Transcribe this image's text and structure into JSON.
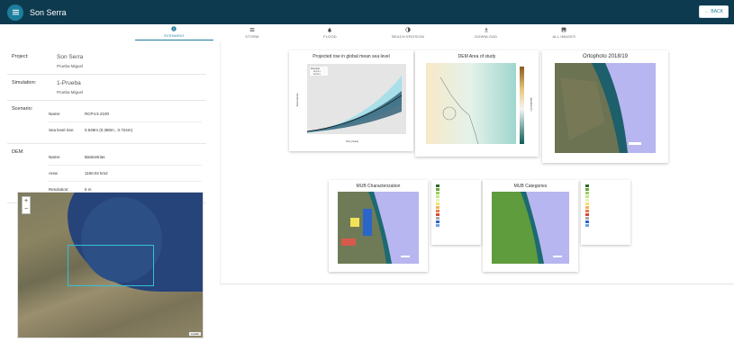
{
  "app": {
    "title": "Son Serra",
    "back_label": "BACK"
  },
  "tabs": [
    {
      "label": "SCENARIO",
      "icon": "info-icon",
      "active": true
    },
    {
      "label": "STORM",
      "icon": "storm-icon",
      "active": false
    },
    {
      "label": "FLOOD",
      "icon": "water-drop-icon",
      "active": false
    },
    {
      "label": "BEACH EROSION",
      "icon": "erosion-icon",
      "active": false
    },
    {
      "label": "DOWNLOAD",
      "icon": "download-icon",
      "active": false
    },
    {
      "label": "ALL IMAGES",
      "icon": "image-icon",
      "active": false
    }
  ],
  "info": {
    "project_label": "Project:",
    "project_name": "Son Serra",
    "project_owner": "Prueba Miguel",
    "simulation_label": "Simulation:",
    "simulation_name": "1-Prueba",
    "simulation_owner": "Prueba Miguel",
    "scenario_label": "Scenario:",
    "scenario_name_key": "Name:",
    "scenario_name": "RCP4.5 2100",
    "sea_level_key": "Sea level rise:",
    "sea_level": "0.549m (0.380m , 0.724m)",
    "dem_label": "DEM:",
    "dem_name_key": "Name:",
    "dem_name": "Batimetrias",
    "dem_area_key": "Area:",
    "dem_area": "1160.02 km2",
    "dem_res_key": "Resolution:",
    "dem_res": "5 m"
  },
  "map": {
    "zoom_in": "+",
    "zoom_out": "−",
    "attribution": "Leaflet"
  },
  "cards": {
    "sea_level_title": "Projected rise in global mean sea level",
    "sea_level_legend_title": "Scenario",
    "sea_level_legend": [
      "RCP4.5",
      "RCP8.5"
    ],
    "sea_level_xlabel": "Time (Years)",
    "sea_level_ylabel": "Sea level rise",
    "dem_title": "DEM Area of study",
    "dem_colorbar_label": "Elevation (m)",
    "ortho_title": "Ortophoto 2018/19",
    "mu_char_title": "MUB Characterization",
    "mu_cat_title": "MUB Categories"
  }
}
